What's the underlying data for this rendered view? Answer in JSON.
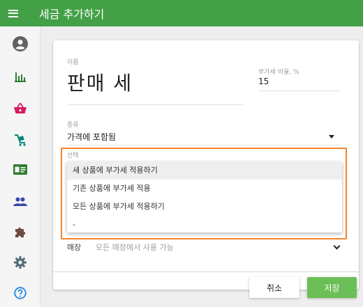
{
  "app_bar": {
    "title": "세금 추가하기"
  },
  "form": {
    "name_label": "이름",
    "name_value": "판매 세",
    "tax_rate_label": "부가세 비율, %",
    "tax_rate_value": "15",
    "type_label": "종류",
    "type_value": "가격에 포함됨",
    "apply_label": "선택",
    "apply_options": [
      "새 상품에 부가세 적용하기",
      "기존 상품에 부가세 적용",
      "모든 상품에 부가세 적용하기",
      "-"
    ],
    "apply_selected_index": 0,
    "store_label": "매장",
    "store_value": "모든 매장에서 사용 가능"
  },
  "actions": {
    "cancel": "취소",
    "save": "저장"
  },
  "colors": {
    "primary": "#43a047",
    "accent_icon": "#2e7d32",
    "pink_icon": "#d81b60",
    "highlight": "#f5832a",
    "save_button": "#6cbf56"
  },
  "rail_icons": [
    "account-circle-icon",
    "bar-chart-icon",
    "shopping-basket-icon",
    "cart-icon",
    "id-card-icon",
    "people-icon",
    "puzzle-icon",
    "settings-icon",
    "help-icon"
  ]
}
